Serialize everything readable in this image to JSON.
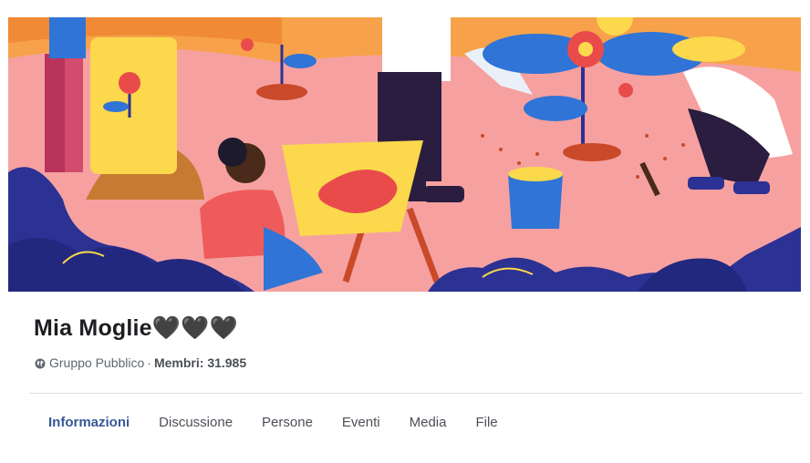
{
  "cover": {
    "image": "cover-illustration-gardening",
    "colors": {
      "background": "#f6a1a0",
      "sky": "#f7a24a",
      "shrub": "#2c3194",
      "accent_blue": "#2f74d6",
      "accent_yellow": "#fbd84c",
      "accent_red": "#e94b4b"
    }
  },
  "group": {
    "name": "Mia Moglie🖤🖤🖤",
    "privacy_icon": "globe-icon",
    "privacy_label": "Gruppo Pubblico",
    "separator": "·",
    "members_label": "Membri:",
    "members_count": "31.985"
  },
  "tabs": [
    {
      "label": "Informazioni",
      "active": true
    },
    {
      "label": "Discussione",
      "active": false
    },
    {
      "label": "Persone",
      "active": false
    },
    {
      "label": "Eventi",
      "active": false
    },
    {
      "label": "Media",
      "active": false
    },
    {
      "label": "File",
      "active": false
    }
  ]
}
